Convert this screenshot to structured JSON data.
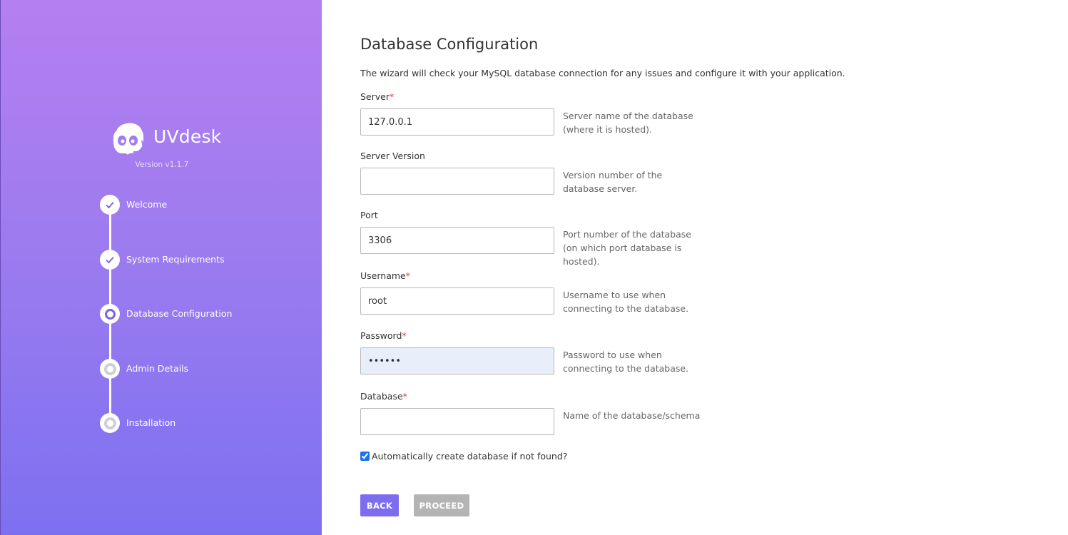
{
  "sidebar": {
    "brand_name": "UVdesk",
    "version": "Version v1.1.7",
    "steps": [
      {
        "label": "Welcome",
        "state": "done"
      },
      {
        "label": "System Requirements",
        "state": "done"
      },
      {
        "label": "Database Configuration",
        "state": "active"
      },
      {
        "label": "Admin Details",
        "state": "pending"
      },
      {
        "label": "Installation",
        "state": "pending"
      }
    ]
  },
  "main": {
    "title": "Database Configuration",
    "description": "The wizard will check your MySQL database connection for any issues and configure it with your application.",
    "fields": {
      "server": {
        "label": "Server",
        "required_mark": "*",
        "value": "127.0.0.1",
        "help": "Server name of the database (where it is hosted)."
      },
      "server_version": {
        "label": "Server Version",
        "value": "",
        "help": "Version number of the database server."
      },
      "port": {
        "label": "Port",
        "value": "3306",
        "help": "Port number of the database (on which port database is hosted)."
      },
      "username": {
        "label": "Username",
        "required_mark": "*",
        "value": "root",
        "help": "Username to use when connecting to the database."
      },
      "password": {
        "label": "Password",
        "required_mark": "*",
        "value": "••••••",
        "help": "Password to use when connecting to the database."
      },
      "database": {
        "label": "Database",
        "required_mark": "*",
        "value": "",
        "help": "Name of the database/schema"
      }
    },
    "auto_create": {
      "label": "Automatically create database if not found?",
      "checked": true
    },
    "buttons": {
      "back": "BACK",
      "proceed": "PROCEED"
    }
  },
  "colors": {
    "sidebar_top": "#b57ff0",
    "sidebar_bottom": "#7d70f0",
    "accent": "#7c6cf0",
    "required": "#e53935",
    "disabled_button": "#b4b4b4"
  },
  "icons": {
    "logo": "uvdesk-agent-icon",
    "step_done": "check-icon",
    "step_active": "ring-icon",
    "step_pending": "ring-icon"
  }
}
